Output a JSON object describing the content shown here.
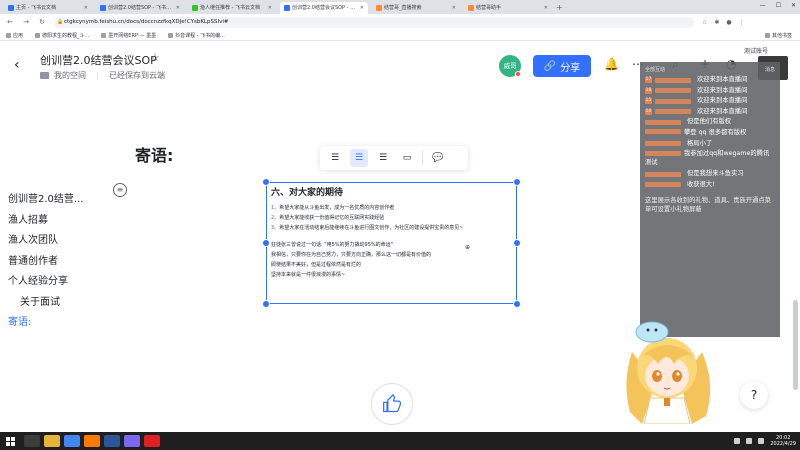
{
  "browser": {
    "tabs": [
      {
        "label": "主页 - 飞书云文档",
        "active": false,
        "favicon": "blue"
      },
      {
        "label": "创训营2.0结营SOP - 飞书云文档",
        "active": false,
        "favicon": "blue"
      },
      {
        "label": "渔人继任推荐 - 飞书云文档",
        "active": false,
        "favicon": "green"
      },
      {
        "label": "创训营2.0结营会议SOP - 飞书云文档",
        "active": true,
        "favicon": "blue"
      },
      {
        "label": "结营哥_直播搜索",
        "active": false,
        "favicon": "orange"
      },
      {
        "label": "结营哥助手",
        "active": false,
        "favicon": "orange"
      }
    ],
    "url": "ctgkcynymb.feishu.cn/docs/doccnzzfkqXDJe!CYsbKLpSSIvl#",
    "bookmarks": [
      "应用",
      "德阳求生的教程_斗...",
      "墨开网络ERP — 墨墨",
      "抖音课程 - 飞书的编..."
    ],
    "bookmarks_right": "其他书签"
  },
  "doc": {
    "title": "创训营2.0结营会议SOP",
    "location": "我的空间",
    "save_status": "已经保存到云端",
    "avatar_text": "威哥",
    "share_label": "分享",
    "heading": "寄语:"
  },
  "toc": {
    "items": [
      {
        "label": "创训营2.0结营...",
        "level": 1,
        "active": false
      },
      {
        "label": "渔人招募",
        "level": 1,
        "active": false
      },
      {
        "label": "渔人次团队",
        "level": 1,
        "active": false
      },
      {
        "label": "普通创作者",
        "level": 1,
        "active": false
      },
      {
        "label": "个人经验分享",
        "level": 1,
        "active": false
      },
      {
        "label": "关于面试",
        "level": 2,
        "active": false
      },
      {
        "label": "寄语:",
        "level": 1,
        "active": true
      }
    ]
  },
  "image_block": {
    "heading": "六、对大家的期待",
    "points": [
      {
        "num": "1、",
        "text": "希望大家能从斗鱼出发，成为一名优质的内容创作者"
      },
      {
        "num": "2、",
        "text": "希望大家能收获一份值得记忆的互联网实践经验"
      },
      {
        "num": "3、",
        "text": "希望大家在活动结束后能继续在斗鱼进行图文创作，为社区的建设提供宝贵的意见~"
      }
    ],
    "quote_lines": [
      "狂徒张三曾说过一句话: \"用5%的努力撬动95%的命运\"",
      "我相信，只要你在为自己努力，只要方向正确，那么这一切都是有价值的",
      "即使结果不美好，但是过程依然是有烂的",
      "坚持本来就是一件很浪漫的事情~"
    ]
  },
  "chat": {
    "top_left": "全部互动",
    "top_right": "消息",
    "messages": [
      {
        "badge": "17",
        "user": "",
        "text": "欢迎来到本直播间"
      },
      {
        "badge": "18",
        "user": "",
        "text": "欢迎来到本直播间"
      },
      {
        "badge": "15",
        "user": "",
        "text": "欢迎来到本直播间"
      },
      {
        "badge": "16",
        "user": "",
        "text": "欢迎来到本直播间"
      },
      {
        "badge": "",
        "user": "",
        "text": "但是他们有版权"
      },
      {
        "badge": "",
        "user": "",
        "text": "攀登 qq 很多都有版权",
        "wrap": true
      },
      {
        "badge": "",
        "user": "",
        "text": "格局小了"
      },
      {
        "badge": "",
        "user": "",
        "text": "我参加过qq和wegame的腾讯测试",
        "wrap": true
      },
      {
        "badge": "",
        "user": "",
        "text": "但是我想来斗鱼实习"
      },
      {
        "badge": "",
        "user": "",
        "text": "收获很大!"
      }
    ],
    "notice": "这里展示各收到的礼物、道具、贵族开通点菜单可设置小礼物屏蔽"
  },
  "overlay": {
    "streamer_tag": "测试账号"
  },
  "taskbar": {
    "time": "20:02",
    "date": "2022/4/29"
  },
  "colors": {
    "accent": "#3370ff",
    "avatar": "#34b486",
    "chat_bg": "#606266",
    "username": "#ff9a5a"
  }
}
